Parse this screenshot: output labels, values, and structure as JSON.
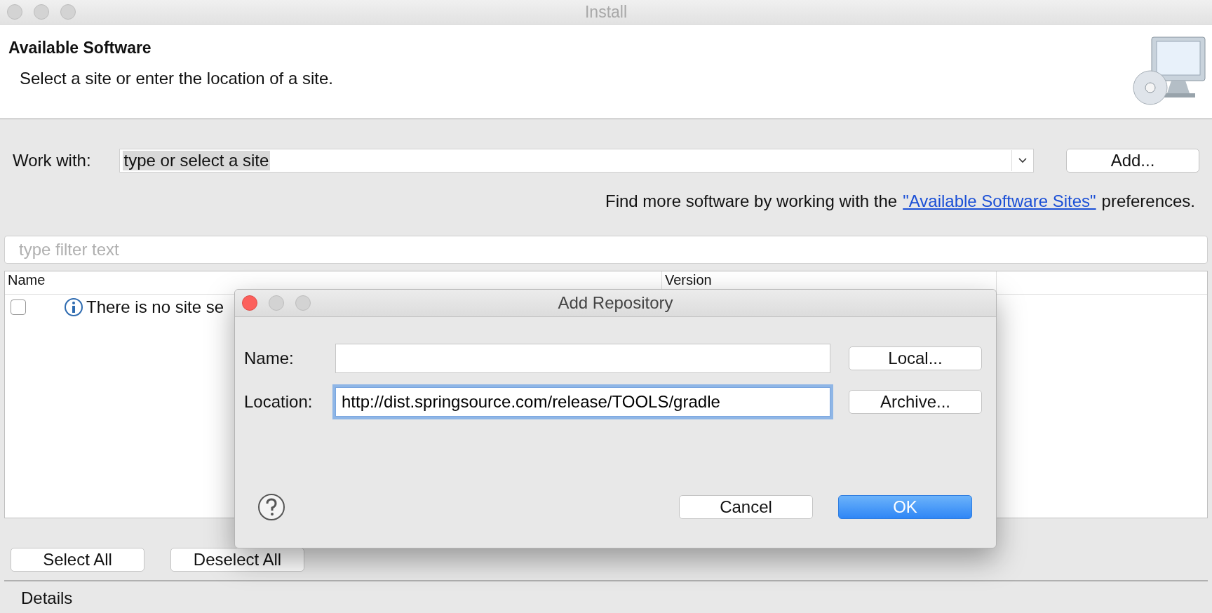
{
  "window": {
    "title": "Install"
  },
  "header": {
    "title": "Available Software",
    "subtitle": "Select a site or enter the location of a site."
  },
  "work_with": {
    "label": "Work with:",
    "value": "type or select a site",
    "button": "Add..."
  },
  "hint": {
    "before": "Find more software by working with the",
    "link": "\"Available Software Sites\"",
    "after": "preferences."
  },
  "filter": {
    "placeholder": "type filter text"
  },
  "table": {
    "columns": [
      "Name",
      "Version"
    ],
    "rows": [
      {
        "checked": false,
        "text": "There is no site se"
      }
    ]
  },
  "buttons": [
    "Select All",
    "Deselect All"
  ],
  "details": "Details",
  "dialog": {
    "title": "Add Repository",
    "fields": [
      {
        "label": "Name:",
        "focused": false,
        "button": "Local..."
      },
      {
        "label": "Location:",
        "value": "http://dist.springsource.com/release/TOOLS/gradle",
        "focused": true,
        "button": "Archive..."
      }
    ],
    "buttons": [
      {
        "label": "Cancel",
        "default": false
      },
      {
        "label": "OK",
        "default": true
      }
    ]
  }
}
